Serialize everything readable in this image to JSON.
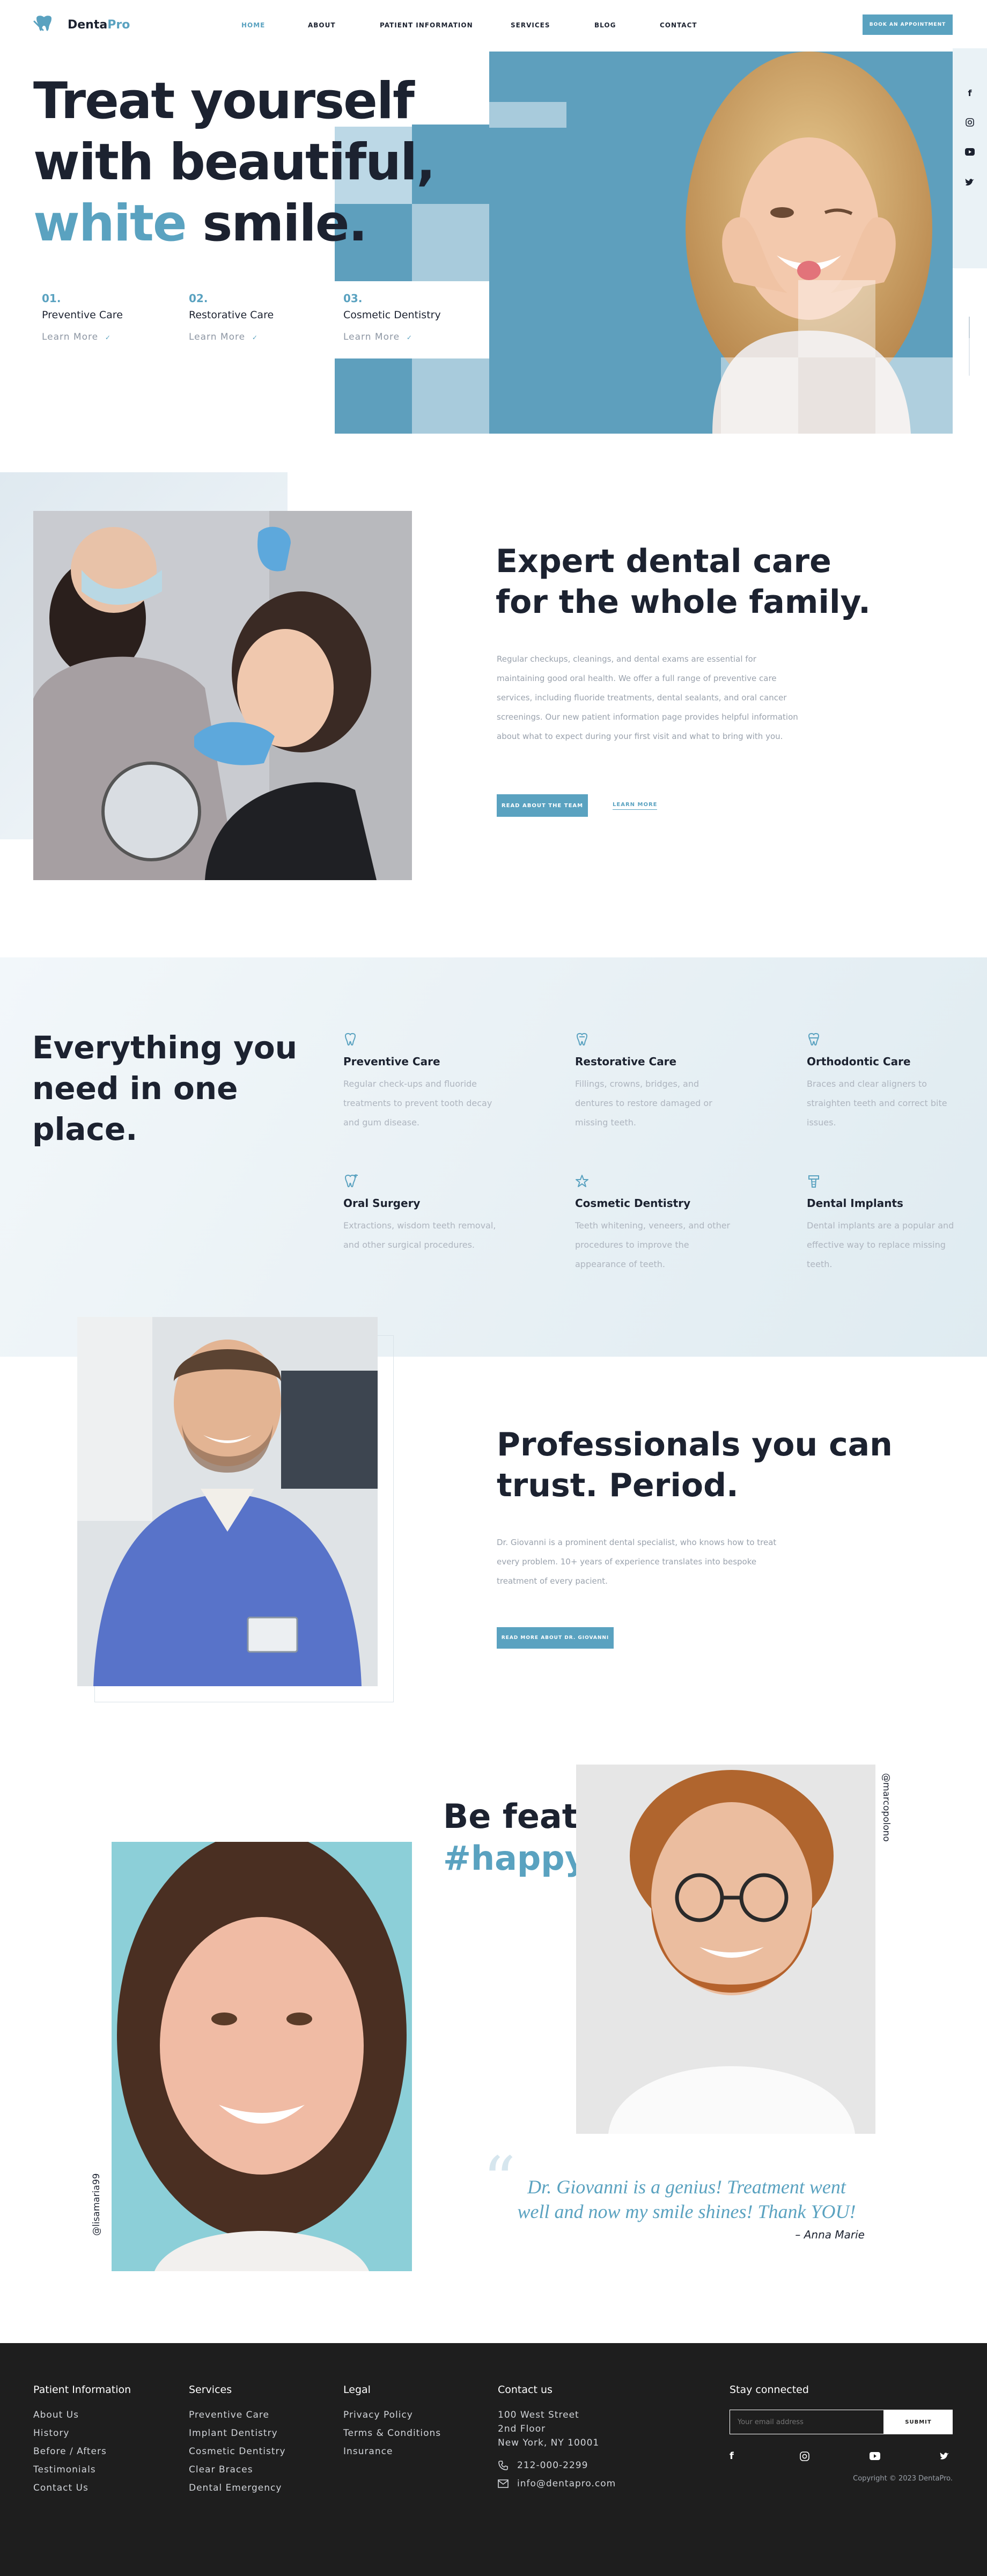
{
  "brand": {
    "name_dark": "Denta",
    "name_accent": "Pro"
  },
  "nav": {
    "home": "HOME",
    "about": "ABOUT",
    "patient": "PATIENT INFORMATION",
    "services": "SERVICES",
    "blog": "BLOG",
    "contact": "CONTACT",
    "cta": "BOOK AN APPOINTMENT"
  },
  "hero": {
    "line1": "Treat yourself",
    "line2": "with beautiful,",
    "accent_word": "white",
    "line3_rest": " smile.",
    "features": [
      {
        "num": "01.",
        "title": "Preventive Care",
        "link": "Learn More"
      },
      {
        "num": "02.",
        "title": "Restorative Care",
        "link": "Learn More"
      },
      {
        "num": "03.",
        "title": "Cosmetic Dentistry",
        "link": "Learn More"
      }
    ]
  },
  "about": {
    "title_line1": "Expert dental care",
    "title_line2": "for the whole family.",
    "body": "Regular checkups, cleanings, and dental exams are essential for maintaining good oral health. We offer a full range of preventive care services, including fluoride treatments, dental sealants, and oral cancer screenings. Our new patient information page provides helpful information about what to expect during your first visit and what to bring with you.",
    "btn": "READ ABOUT THE TEAM",
    "link": "LEARN MORE"
  },
  "services": {
    "title_line1": "Everything you",
    "title_line2": "need in one",
    "title_line3": "place.",
    "items": [
      {
        "icon": "tooth-icon",
        "title": "Preventive Care",
        "text": "Regular check-ups and fluoride treatments to prevent tooth decay and gum disease."
      },
      {
        "icon": "tooth-crown-icon",
        "title": "Restorative Care",
        "text": "Fillings, crowns, bridges, and dentures to restore damaged or missing teeth."
      },
      {
        "icon": "braces-icon",
        "title": "Orthodontic Care",
        "text": "Braces and clear aligners to straighten teeth and correct bite issues."
      },
      {
        "icon": "tooth-surgery-icon",
        "title": "Oral Surgery",
        "text": "Extractions, wisdom teeth removal, and other surgical procedures."
      },
      {
        "icon": "star-icon",
        "title": "Cosmetic Dentistry",
        "text": "Teeth whitening, veneers, and other procedures to improve the appearance of teeth."
      },
      {
        "icon": "implant-icon",
        "title": "Dental Implants",
        "text": "Dental implants are a popular and effective way to replace missing teeth."
      }
    ]
  },
  "pro": {
    "title_line1": "Professionals you can",
    "title_line2": "trust. Period.",
    "body": "Dr. Giovanni is a prominent dental specialist, who knows how to treat every problem. 10+ years of experience translates into bespoke treatment of every pacient.",
    "btn": "READ MORE ABOUT DR. GIOVANNI"
  },
  "featured": {
    "title": "Be featured.",
    "hashtag": "#happysmile",
    "handle_left": "@lisamaria99",
    "handle_right": "@marcopolono",
    "quote_line1": "Dr. Giovanni is a genius! Treatment went",
    "quote_line2": "well and now my smile shines! Thank YOU!",
    "author": "– Anna Marie"
  },
  "footer": {
    "col1": {
      "title": "Patient Information",
      "links": [
        "About Us",
        "History",
        "Before / Afters",
        "Testimonials",
        "Contact Us"
      ]
    },
    "col2": {
      "title": "Services",
      "links": [
        "Preventive Care",
        "Implant Dentistry",
        "Cosmetic Dentistry",
        "Clear Braces",
        "Dental Emergency"
      ]
    },
    "col3": {
      "title": "Legal",
      "links": [
        "Privacy Policy",
        "Terms & Conditions",
        "Insurance"
      ]
    },
    "contact": {
      "title": "Contact us",
      "addr1": "100 West Street",
      "addr2": "2nd Floor",
      "addr3": "New York, NY 10001",
      "phone": "212-000-2299",
      "email": "info@dentapro.com"
    },
    "stay": {
      "title": "Stay connected",
      "placeholder": "Your email address",
      "submit": "SUBMIT",
      "copyright": "Copyright © 2023 DentaPro."
    }
  },
  "colors": {
    "accent": "#5aa2c0",
    "dark": "#1c2230",
    "footer_bg": "#1e1e1e"
  }
}
